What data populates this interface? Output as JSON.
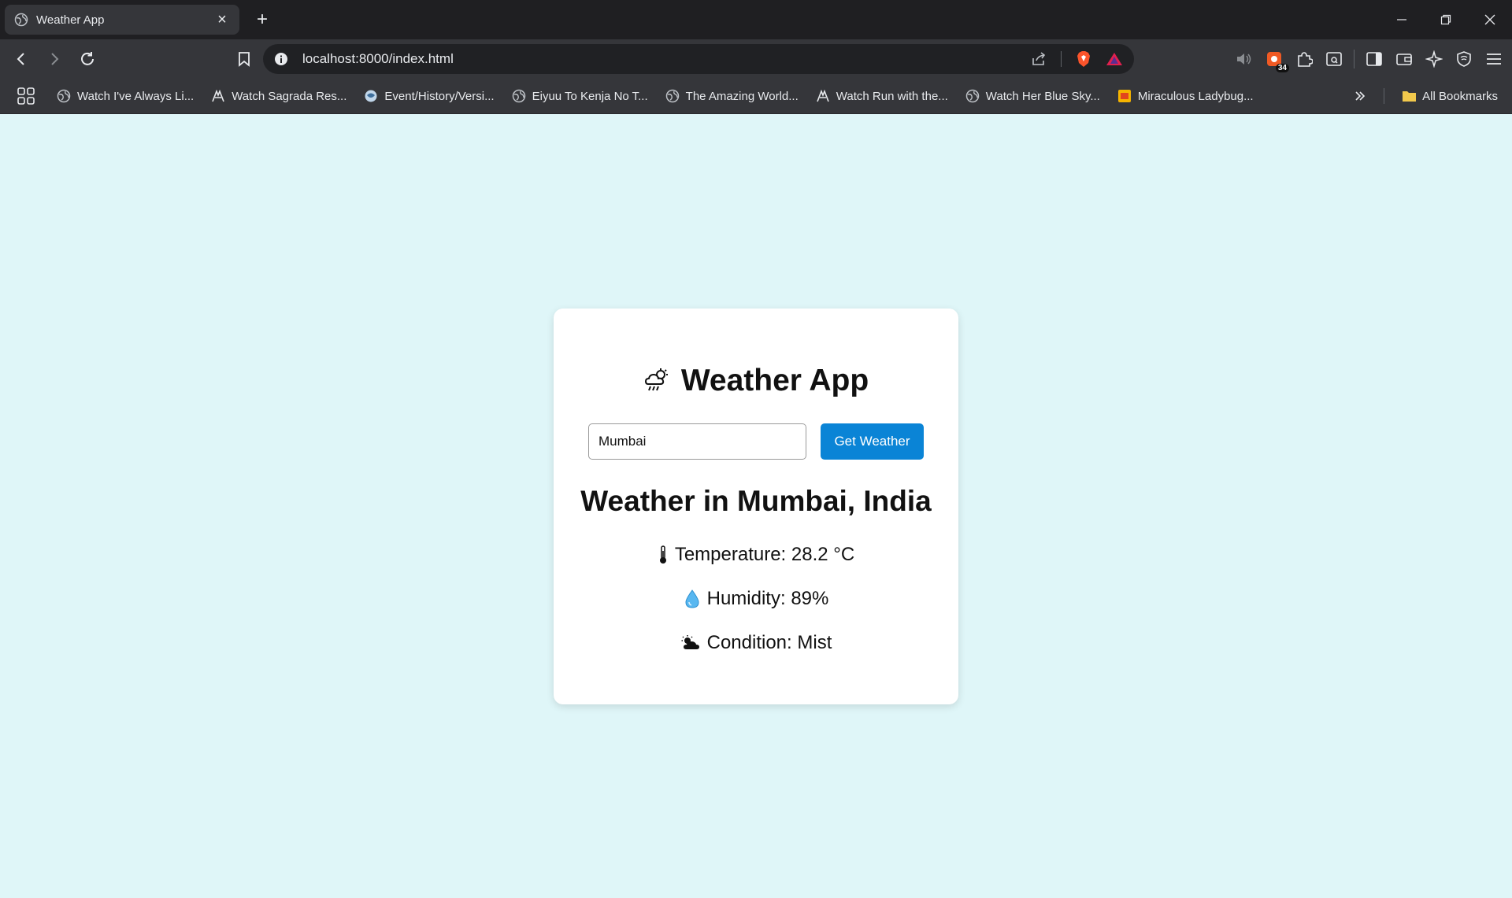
{
  "browser": {
    "tab_title": "Weather App",
    "url": "localhost:8000/index.html",
    "extension_badge": "34",
    "bookmarks": [
      {
        "label": "Watch I've Always Li...",
        "icon": "globe-icon"
      },
      {
        "label": "Watch Sagrada Res...",
        "icon": "anime-site-icon"
      },
      {
        "label": "Event/History/Versi...",
        "icon": "wiki-icon"
      },
      {
        "label": "Eiyuu To Kenja No T...",
        "icon": "globe-icon"
      },
      {
        "label": "The Amazing World...",
        "icon": "globe-icon"
      },
      {
        "label": "Watch Run with the...",
        "icon": "anime-site-icon"
      },
      {
        "label": "Watch Her Blue Sky...",
        "icon": "globe-icon"
      },
      {
        "label": "Miraculous Ladybug...",
        "icon": "fandom-icon"
      }
    ],
    "all_bookmarks": "All Bookmarks"
  },
  "app": {
    "title": "Weather App",
    "title_icon": "cloud-rain-icon",
    "search": {
      "value": "Mumbai",
      "placeholder": ""
    },
    "button_label": "Get Weather",
    "result_title": "Weather in Mumbai, India",
    "temperature": "Temperature: 28.2 °C",
    "humidity": "Humidity: 89%",
    "condition": "Condition: Mist"
  },
  "colors": {
    "page_bg": "#dff6f8",
    "button_bg": "#0a84d6",
    "chrome_dark": "#1f1f22",
    "chrome_toolbar": "#35363a"
  }
}
